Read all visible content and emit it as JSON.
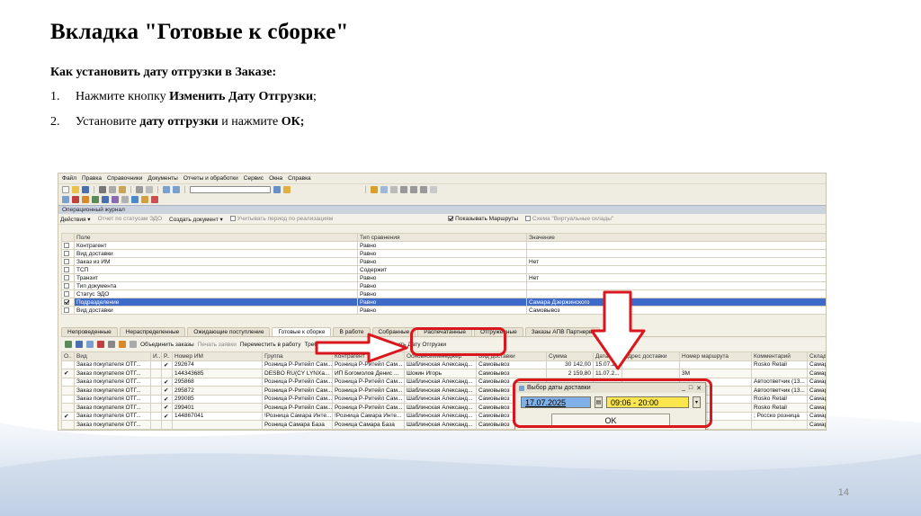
{
  "slide": {
    "title": "Вкладка \"Готовые к сборке\"",
    "subhead": "Как установить дату отгрузки в Заказе:",
    "steps": [
      {
        "num": "1.",
        "pre": "Нажмите кнопку ",
        "bold": "Изменить Дату Отгрузки",
        "post": ";",
        "bold2": "",
        "post2": ""
      },
      {
        "num": "2.",
        "pre": "Установите ",
        "bold": "дату отгрузки",
        "post": " и нажмите ",
        "bold2": "ОК;",
        "post2": ""
      }
    ],
    "page_number": "14"
  },
  "app": {
    "menu": [
      "Файл",
      "Правка",
      "Справочники",
      "Документы",
      "Отчеты и обработки",
      "Сервис",
      "Окна",
      "Справка"
    ],
    "journal_title": "Операционный журнал",
    "actions": {
      "label": "Действия ▾",
      "filter_edo": "Отчет по статусам ЭДО",
      "create_doc": "Создать документ ▾",
      "period_check": "Учитывать период по реализациям",
      "routes_check": "Показывать Маршруты",
      "scheme_check": "Схема \"Виртуальные склады\""
    },
    "filter_table": {
      "headers": [
        "Поле",
        "Тип сравнения",
        "Значение"
      ],
      "rows": [
        {
          "checked": false,
          "field": "Контрагент",
          "cmp": "Равно",
          "value": ""
        },
        {
          "checked": false,
          "field": "Вид доставки",
          "cmp": "Равно",
          "value": ""
        },
        {
          "checked": false,
          "field": "Заказ из ИМ",
          "cmp": "Равно",
          "value": "Нет"
        },
        {
          "checked": false,
          "field": "ТСП",
          "cmp": "Содержит",
          "value": ""
        },
        {
          "checked": false,
          "field": "Транзит",
          "cmp": "Равно",
          "value": "Нет"
        },
        {
          "checked": false,
          "field": "Тип документа",
          "cmp": "Равно",
          "value": ""
        },
        {
          "checked": false,
          "field": "Статус ЭДО",
          "cmp": "Равно",
          "value": ""
        },
        {
          "checked": true,
          "field": "Подразделение",
          "cmp": "Равно",
          "value": "Самара Дзержинского",
          "selected": true
        },
        {
          "checked": false,
          "field": "Вид доставки",
          "cmp": "Равно",
          "value": "Самовывоз"
        }
      ]
    },
    "tabs": [
      "Непроведенные",
      "Нераспределенные",
      "Ожидающие поступление",
      "Готовые к сборке",
      "В работе",
      "Собранные",
      "Распечатанные",
      "Отгруженные",
      "Заказы АПВ Партнеры"
    ],
    "active_tab": "Готовые к сборке",
    "subtoolbar": {
      "merge": "Объединить заказы",
      "print": "Печать заявки",
      "move": "Переместить в работу",
      "requirement": "Требование - накладная",
      "change_date": "Изменить Дату Отгрузки"
    },
    "orders_table": {
      "headers": [
        "О..",
        "Вид",
        "И..",
        "Р..",
        "Номер ИМ",
        "Группа",
        "Контрагент",
        "ОсновнойМенеджер",
        "Вид доставки",
        "Сумма",
        "Дата от...",
        "Адрес доставки",
        "Номер маршрута",
        "Комментарий",
        "Склад"
      ],
      "rows": [
        {
          "o": "",
          "kind": "Заказ покупателя ОТГ...",
          "i": "",
          "r": "✔",
          "im": "292674",
          "group": "Розница Р-Ритейл Сам...",
          "contractor": "Розница Р-Ритейл Сам...",
          "manager": "Шаблинская Александ...",
          "delivery": "Самовывоз",
          "sum": "30 142,00",
          "date": "15.07.2...",
          "address": "",
          "route": "",
          "comment": "Rosko Retail",
          "store": "Самар"
        },
        {
          "o": "✔",
          "kind": "Заказ покупателя ОТГ...",
          "i": "",
          "r": "",
          "im": "144343685",
          "group": "DESBO RU(CY LYNXa...",
          "contractor": "ИП Богомолов Денис ...",
          "manager": "Шокин Игорь",
          "delivery": "Самовывоз",
          "sum": "2 159,80",
          "date": "11.07.2...",
          "address": "",
          "route": "3М",
          "comment": "",
          "store": "Самар"
        },
        {
          "o": "",
          "kind": "Заказ покупателя ОТГ...",
          "i": "",
          "r": "✔",
          "im": "295868",
          "group": "Розница Р-Ритейл Сам...",
          "contractor": "Розница Р-Ритейл Сам...",
          "manager": "Шаблинская Александ...",
          "delivery": "Самовывоз",
          "sum": "",
          "date": "",
          "address": "",
          "route": "",
          "comment": "Автоответчик (13...",
          "store": "Самар"
        },
        {
          "o": "",
          "kind": "Заказ покупателя ОТГ...",
          "i": "",
          "r": "✔",
          "im": "295872",
          "group": "Розница Р-Ритейл Сам...",
          "contractor": "Розница Р-Ритейл Сам...",
          "manager": "Шаблинская Александ...",
          "delivery": "Самовывоз",
          "sum": "",
          "date": "",
          "address": "",
          "route": "",
          "comment": "Автоответчик (13...",
          "store": "Самар"
        },
        {
          "o": "",
          "kind": "Заказ покупателя ОТГ...",
          "i": "",
          "r": "✔",
          "im": "299085",
          "group": "Розница Р-Ритейл Сам...",
          "contractor": "Розница Р-Ритейл Сам...",
          "manager": "Шаблинская Александ...",
          "delivery": "Самовывоз",
          "sum": "",
          "date": "",
          "address": "",
          "route": "",
          "comment": "Rosko Retail",
          "store": "Самар"
        },
        {
          "o": "",
          "kind": "Заказ покупателя ОТГ...",
          "i": "",
          "r": "✔",
          "im": "299401",
          "group": "Розница Р-Ритейл Сам...",
          "contractor": "Розница Р-Ритейл Сам...",
          "manager": "Шаблинская Александ...",
          "delivery": "Самовывоз",
          "sum": "",
          "date": "",
          "address": "",
          "route": "",
          "comment": "Rosko Retail",
          "store": "Самар"
        },
        {
          "o": "✔",
          "kind": "Заказ покупателя ОТГ...",
          "i": "",
          "r": "✔",
          "im": "144867041",
          "group": "!Розница Самара Инте...",
          "contractor": "!Розница Самара Инте...",
          "manager": "Шаблинская Александ...",
          "delivery": "Самовывоз",
          "sum": "",
          "date": "",
          "address": "",
          "route": "",
          "comment": "; Росско розница",
          "store": "Самар"
        },
        {
          "o": "",
          "kind": "Заказ покупателя ОТГ...",
          "i": "",
          "r": "",
          "im": "",
          "group": "Розница Самара База",
          "contractor": "Розница Самара База",
          "manager": "Шаблинская Александ...",
          "delivery": "Самовывоз",
          "sum": "",
          "date": "",
          "address": "",
          "route": "",
          "comment": "",
          "store": "Самар"
        }
      ]
    },
    "dialog": {
      "title": "Выбор даты доставки",
      "date": "17.07.2025",
      "time": "09:06 - 20:00",
      "ok": "OK"
    }
  },
  "colors": {
    "highlight_red": "#d9171c",
    "selection_blue": "#3e6bc9",
    "input_yellow": "#fbe64d"
  }
}
